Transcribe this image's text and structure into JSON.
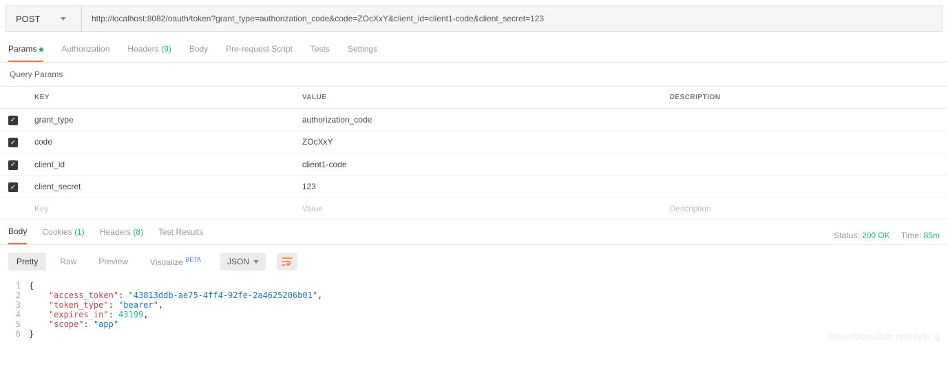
{
  "request": {
    "method": "POST",
    "url": "http://localhost:8082/oauth/token?grant_type=authorization_code&code=ZOcXxY&client_id=client1-code&client_secret=123"
  },
  "req_tabs": {
    "params": "Params",
    "auth": "Authorization",
    "headers": "Headers",
    "headers_count": "(9)",
    "body": "Body",
    "prs": "Pre-request Script",
    "tests": "Tests",
    "settings": "Settings"
  },
  "section_title": "Query Params",
  "table": {
    "head": {
      "key": "KEY",
      "value": "VALUE",
      "desc": "DESCRIPTION"
    },
    "rows": [
      {
        "key": "grant_type",
        "value": "authorization_code"
      },
      {
        "key": "code",
        "value": "ZOcXxY"
      },
      {
        "key": "client_id",
        "value": "client1-code"
      },
      {
        "key": "client_secret",
        "value": "123"
      }
    ],
    "ph": {
      "key": "Key",
      "value": "Value",
      "desc": "Description"
    }
  },
  "resp_tabs": {
    "body": "Body",
    "cookies": "Cookies",
    "cookies_count": "(1)",
    "headers": "Headers",
    "headers_count": "(8)",
    "tests": "Test Results"
  },
  "status": {
    "label": "Status:",
    "value": "200 OK",
    "time_label": "Time:",
    "time_value": "85m"
  },
  "view": {
    "pretty": "Pretty",
    "raw": "Raw",
    "preview": "Preview",
    "visualize": "Visualize",
    "beta": "BETA",
    "format": "JSON"
  },
  "json_body": {
    "access_token": "43813ddb-ae75-4ff4-92fe-2a4625206b01",
    "token_type": "bearer",
    "expires_in": 43199,
    "scope": "app"
  },
  "watermark": "https://blog.csdn.net/myth_g"
}
